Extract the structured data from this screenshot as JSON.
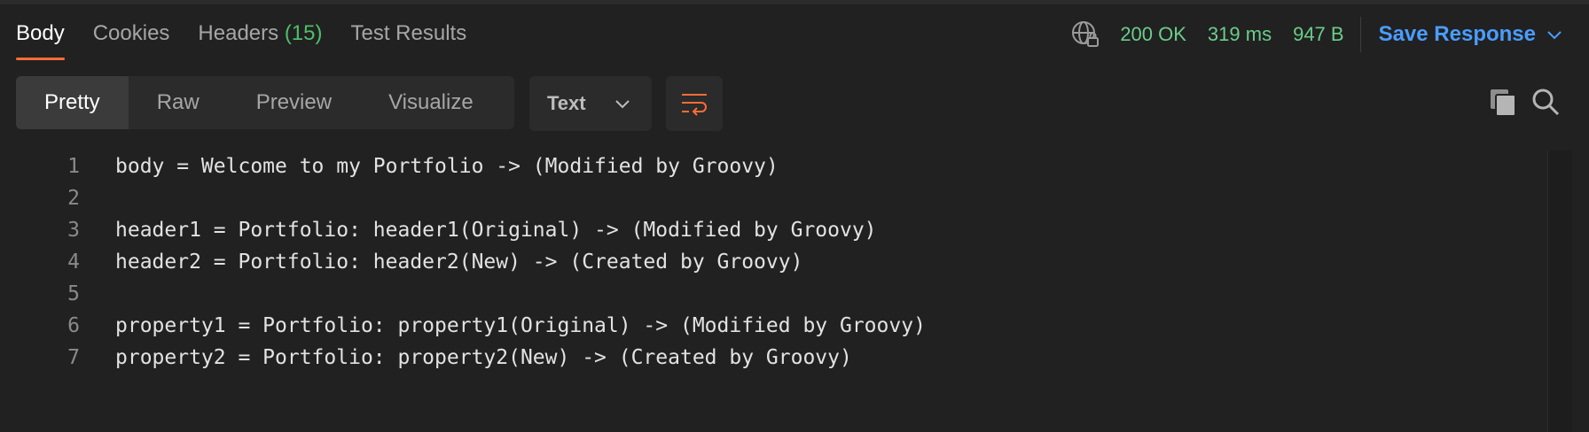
{
  "tabs": [
    {
      "label": "Body",
      "count": ""
    },
    {
      "label": "Headers ",
      "count": "(15)"
    }
  ],
  "tab_cookies": "Cookies",
  "tab_test_results": "Test Results",
  "status": {
    "code": "200 OK",
    "time": "319 ms",
    "size": "947 B",
    "save_response": "Save Response"
  },
  "view_modes": [
    "Pretty",
    "Raw",
    "Preview",
    "Visualize"
  ],
  "format": {
    "selected": "Text"
  },
  "icons": {
    "network": "globe-lock-icon",
    "wrap": "word-wrap-icon",
    "copy": "copy-icon",
    "search": "search-icon",
    "dropdown": "chevron-down-icon"
  },
  "colors": {
    "accent": "#ff6c37",
    "status_green": "#6bcd8a",
    "link_blue": "#4a9dff"
  },
  "code_lines": [
    {
      "n": "1",
      "text": "body = Welcome to my Portfolio -> (Modified by Groovy)"
    },
    {
      "n": "2",
      "text": ""
    },
    {
      "n": "3",
      "text": "header1 = Portfolio: header1(Original) -> (Modified by Groovy)"
    },
    {
      "n": "4",
      "text": "header2 = Portfolio: header2(New) -> (Created by Groovy)"
    },
    {
      "n": "5",
      "text": ""
    },
    {
      "n": "6",
      "text": "property1 = Portfolio: property1(Original) -> (Modified by Groovy)"
    },
    {
      "n": "7",
      "text": "property2 = Portfolio: property2(New) -> (Created by Groovy)"
    }
  ]
}
